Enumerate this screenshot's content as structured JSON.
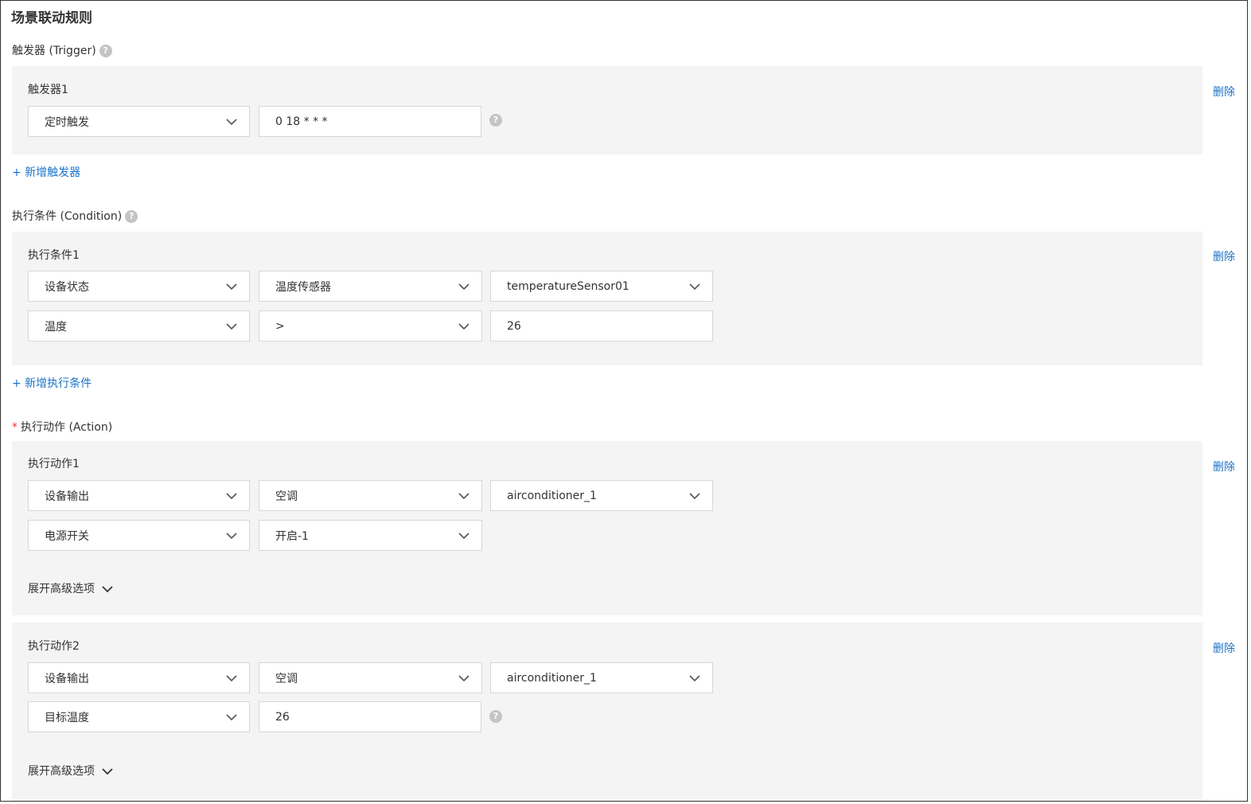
{
  "page": {
    "title": "场景联动规则"
  },
  "icons": {
    "help": "?"
  },
  "trigger": {
    "label": "触发器 (Trigger)",
    "items": [
      {
        "title": "触发器1",
        "type": "定时触发",
        "cron": "0 18 * * *",
        "delete_label": "删除"
      }
    ],
    "add_label": "+ 新增触发器"
  },
  "condition": {
    "label": "执行条件 (Condition)",
    "items": [
      {
        "title": "执行条件1",
        "type": "设备状态",
        "product": "温度传感器",
        "device": "temperatureSensor01",
        "property": "温度",
        "operator": ">",
        "value": "26",
        "delete_label": "删除"
      }
    ],
    "add_label": "+ 新增执行条件"
  },
  "action": {
    "required_mark": "*",
    "label": "执行动作 (Action)",
    "items": [
      {
        "title": "执行动作1",
        "type": "设备输出",
        "product": "空调",
        "device": "airconditioner_1",
        "property": "电源开关",
        "value": "开启-1",
        "advanced_label": "展开高级选项",
        "delete_label": "删除"
      },
      {
        "title": "执行动作2",
        "type": "设备输出",
        "product": "空调",
        "device": "airconditioner_1",
        "property": "目标温度",
        "value": "26",
        "advanced_label": "展开高级选项",
        "delete_label": "删除"
      }
    ]
  }
}
